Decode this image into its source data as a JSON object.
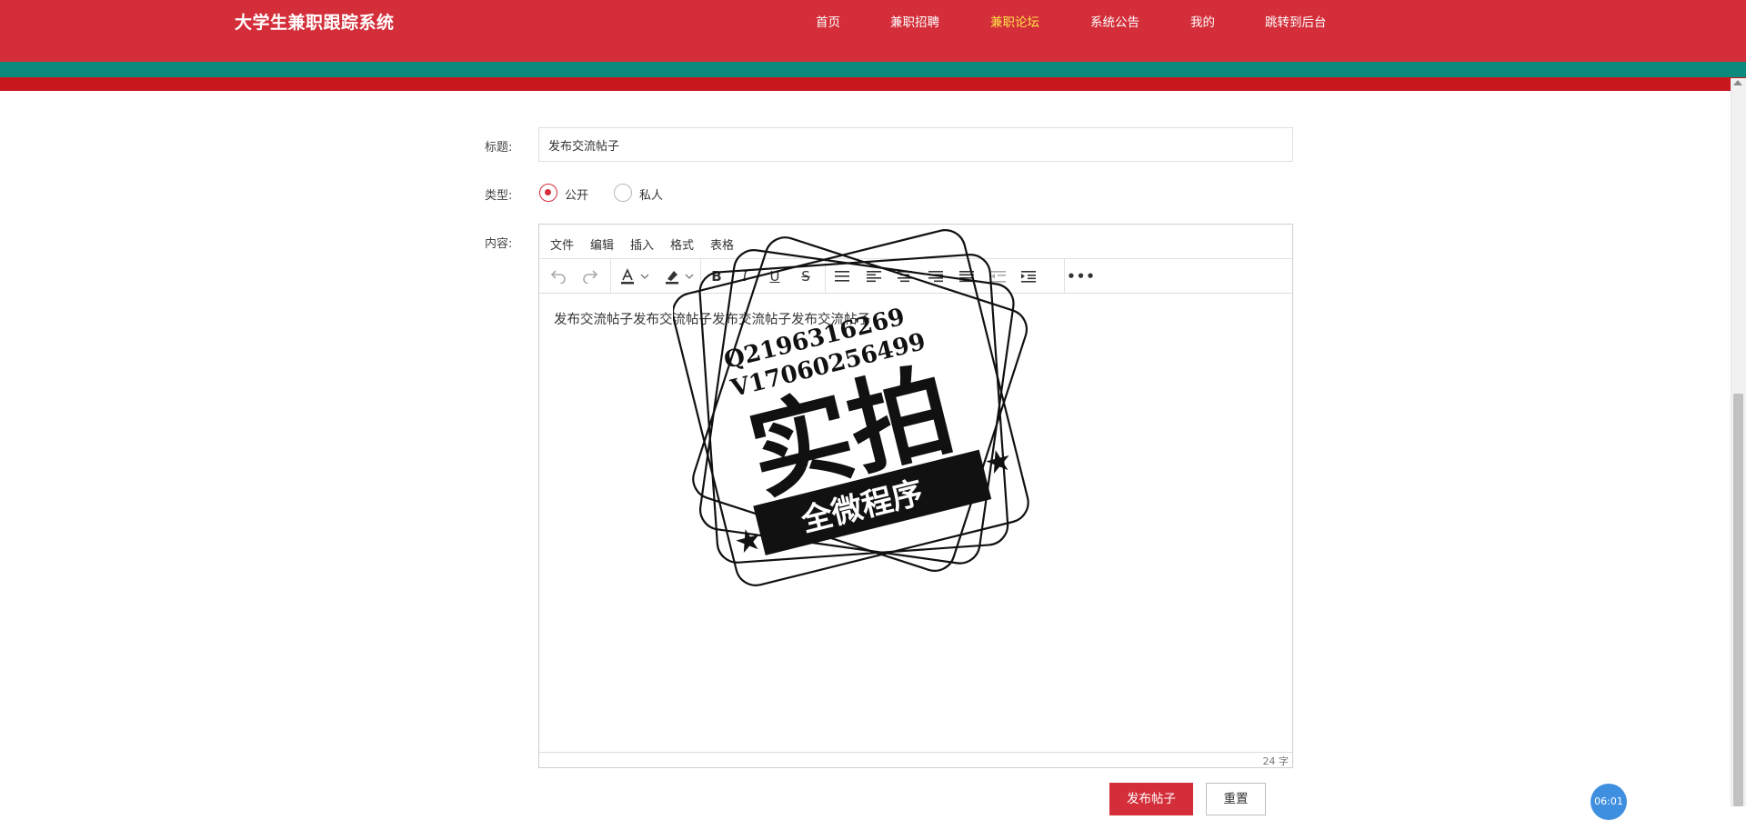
{
  "header": {
    "brand": "大学生兼职跟踪系统",
    "nav": [
      "首页",
      "兼职招聘",
      "兼职论坛",
      "系统公告",
      "我的",
      "跳转到后台"
    ],
    "active_nav": "兼职论坛",
    "colors": {
      "header": "#d32e39",
      "teal_stripe": "#0d8a7e",
      "red_stripe": "#c8171d",
      "active_nav": "#ffe24a"
    }
  },
  "form": {
    "title_label": "标题:",
    "title_value": "发布交流帖子",
    "type_label": "类型:",
    "type_options": [
      "公开",
      "私人"
    ],
    "type_selected": "公开",
    "content_label": "内容:"
  },
  "editor": {
    "menus": [
      "文件",
      "编辑",
      "插入",
      "格式",
      "表格"
    ],
    "toolbar_icons": [
      "undo-icon",
      "redo-icon",
      "text-color-icon",
      "highlight-color-icon",
      "bold-icon",
      "italic-icon",
      "underline-icon",
      "strikethrough-icon",
      "bullet-list-icon",
      "align-left-icon",
      "align-center-icon",
      "align-right-icon",
      "align-justify-icon",
      "outdent-icon",
      "indent-icon",
      "more-icon"
    ],
    "content": "发布交流帖子发布交流帖子发布交流帖子发布交流帖子",
    "word_count": "24 字"
  },
  "buttons": {
    "submit": "发布帖子",
    "reset": "重置"
  },
  "floating": {
    "time": "06:01"
  },
  "watermark": {
    "line1": "Q2196316269",
    "line2": "V17060256499",
    "main": "实拍",
    "ribbon": "全微程序"
  }
}
